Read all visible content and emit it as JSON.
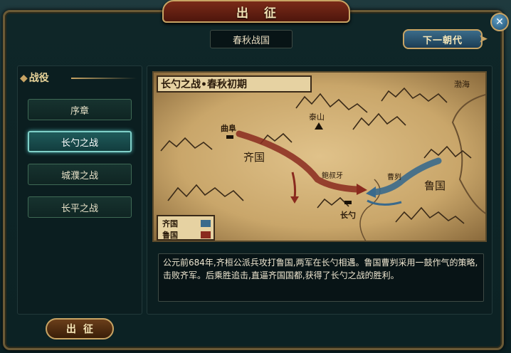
{
  "window": {
    "title": "出征",
    "close_icon": "close-icon"
  },
  "header": {
    "era": "春秋战国",
    "next_era_label": "下一朝代"
  },
  "sidebar": {
    "section_title": "战役",
    "battles": [
      {
        "label": "序章",
        "active": false
      },
      {
        "label": "长勺之战",
        "active": true
      },
      {
        "label": "城濮之战",
        "active": false
      },
      {
        "label": "长平之战",
        "active": false
      }
    ],
    "march_label": "出征"
  },
  "map": {
    "title": "长勺之战•春秋初期",
    "labels": {
      "sea": "渤海",
      "mountain": "泰山",
      "qufu": "曲阜",
      "qi": "齐国",
      "lu": "鲁国",
      "bao_shuya": "鲍叔牙",
      "cao_gui": "曹刿",
      "changshao": "长勺"
    },
    "legend": [
      {
        "label": "齐国",
        "color": "#3a6a8c"
      },
      {
        "label": "鲁国",
        "color": "#8a2a1e"
      }
    ],
    "colors": {
      "qi_arrow": "#8a2a1e",
      "lu_arrow": "#3a6a8c"
    }
  },
  "description": "公元前684年,齐桓公派兵攻打鲁国,两军在长勺相遇。鲁国曹刿采用一鼓作气的策略,击败齐军。后乘胜追击,直逼齐国国都,获得了长勺之战的胜利。"
}
